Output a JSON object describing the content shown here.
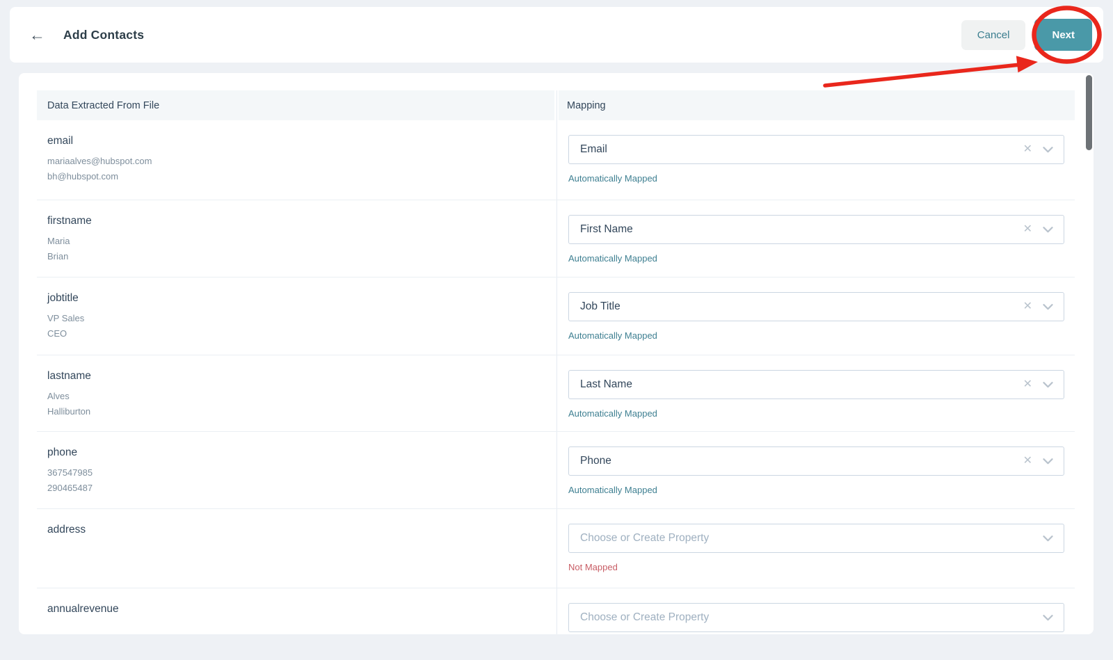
{
  "header": {
    "title": "Add Contacts",
    "back_icon": "←",
    "cancel_label": "Cancel",
    "next_label": "Next"
  },
  "table": {
    "columns": {
      "extracted": "Data Extracted From File",
      "mapping": "Mapping"
    },
    "rows": [
      {
        "field": "email",
        "samples": [
          "mariaalves@hubspot.com",
          "bh@hubspot.com"
        ],
        "mapping": "Email",
        "status": "Automatically Mapped",
        "mapped": true
      },
      {
        "field": "firstname",
        "samples": [
          "Maria",
          "Brian"
        ],
        "mapping": "First Name",
        "status": "Automatically Mapped",
        "mapped": true
      },
      {
        "field": "jobtitle",
        "samples": [
          "VP Sales",
          "CEO"
        ],
        "mapping": "Job Title",
        "status": "Automatically Mapped",
        "mapped": true
      },
      {
        "field": "lastname",
        "samples": [
          "Alves",
          "Halliburton"
        ],
        "mapping": "Last Name",
        "status": "Automatically Mapped",
        "mapped": true
      },
      {
        "field": "phone",
        "samples": [
          "367547985",
          "290465487"
        ],
        "mapping": "Phone",
        "status": "Automatically Mapped",
        "mapped": true
      },
      {
        "field": "address",
        "samples": [],
        "mapping": "",
        "placeholder": "Choose or Create Property",
        "status": "Not Mapped",
        "mapped": false
      },
      {
        "field": "annualrevenue",
        "samples": [],
        "mapping": "",
        "placeholder": "Choose or Create Property",
        "status": "",
        "mapped": false
      }
    ]
  },
  "icons": {
    "back": "arrow-left",
    "clear": "✕",
    "dropdown": "chevron-down"
  },
  "annotation": {
    "type": "circle-and-arrow",
    "target": "Next",
    "color": "#e9271c"
  },
  "colors": {
    "accent_teal": "#4a99a8",
    "cancel_text": "#3a7d8e",
    "mapped_status": "#3e7f91",
    "not_mapped_status": "#c85d65",
    "annotation_red": "#e9271c",
    "page_background": "#eef1f5",
    "table_header_background": "#f4f7f9",
    "text_primary": "#33475b",
    "text_secondary": "#7e8e9c",
    "select_border": "#cbd6e2",
    "scrollbar_thumb": "#6d7276"
  }
}
